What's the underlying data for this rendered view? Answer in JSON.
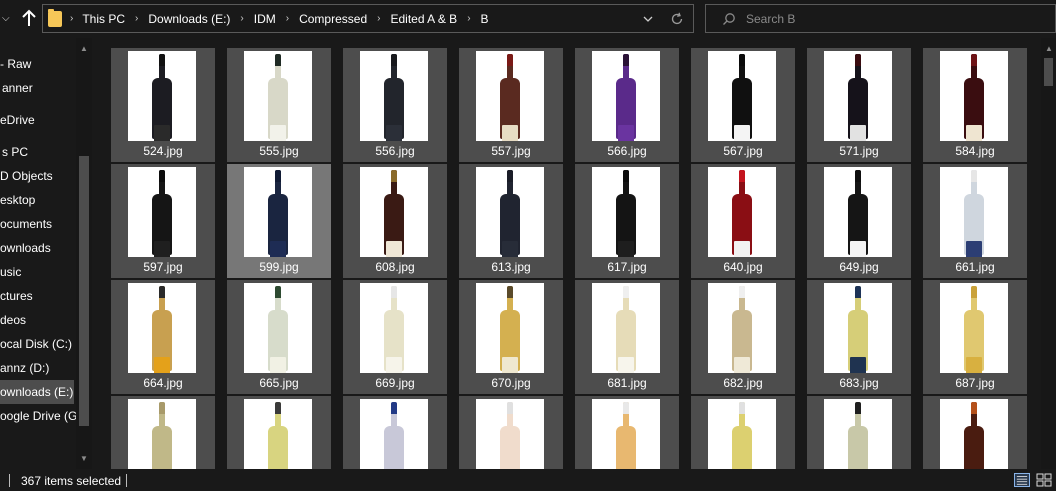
{
  "address": {
    "crumbs": [
      "This PC",
      "Downloads (E:)",
      "IDM",
      "Compressed",
      "Edited A & B",
      "B"
    ]
  },
  "search": {
    "placeholder": "Search B"
  },
  "nav_pane": {
    "items": [
      {
        "label": "- Raw"
      },
      {
        "label": "anner"
      },
      {
        "label": "eDrive"
      },
      {
        "label": "s PC"
      },
      {
        "label": "D Objects"
      },
      {
        "label": "esktop"
      },
      {
        "label": "ocuments"
      },
      {
        "label": "ownloads"
      },
      {
        "label": "usic"
      },
      {
        "label": "ctures"
      },
      {
        "label": "deos"
      },
      {
        "label": "ocal Disk (C:)"
      },
      {
        "label": "annz (D:)"
      },
      {
        "label": "ownloads (E:)",
        "selected": true
      },
      {
        "label": "oogle Drive (G:"
      }
    ]
  },
  "files": [
    {
      "name": "524.jpg",
      "color": "#1c1c22",
      "label": "#2a2a2a",
      "capsule": "#111"
    },
    {
      "name": "555.jpg",
      "color": "#d8d8c8",
      "label": "#f2f2ea",
      "capsule": "#1f2a24"
    },
    {
      "name": "556.jpg",
      "color": "#22252c",
      "label": "#2b2f38",
      "capsule": "#18191d"
    },
    {
      "name": "557.jpg",
      "color": "#5a2a20",
      "label": "#e7dcc4",
      "capsule": "#7a1a16"
    },
    {
      "name": "566.jpg",
      "color": "#5a2a8a",
      "label": "#6a34a0",
      "capsule": "#2a1236"
    },
    {
      "name": "567.jpg",
      "color": "#101010",
      "label": "#f4f4f4",
      "capsule": "#0a0a0a"
    },
    {
      "name": "571.jpg",
      "color": "#15121a",
      "label": "#e2e2e2",
      "capsule": "#3a0c10"
    },
    {
      "name": "584.jpg",
      "color": "#3a0d10",
      "label": "#efe5d1",
      "capsule": "#6e1417"
    },
    {
      "name": "597.jpg",
      "color": "#151515",
      "label": "#1f1f1f",
      "capsule": "#0c0c0c"
    },
    {
      "name": "599.jpg",
      "color": "#1a2540",
      "label": "#1e2c54",
      "capsule": "#101a34",
      "hover": true
    },
    {
      "name": "608.jpg",
      "color": "#3a1a14",
      "label": "#efe7d6",
      "capsule": "#8a6a2a"
    },
    {
      "name": "613.jpg",
      "color": "#202430",
      "label": "#272c38",
      "capsule": "#1a1d27"
    },
    {
      "name": "617.jpg",
      "color": "#141414",
      "label": "#1e1e1e",
      "capsule": "#0c0c0c"
    },
    {
      "name": "640.jpg",
      "color": "#8a0e14",
      "label": "#f2f2f2",
      "capsule": "#c4141e"
    },
    {
      "name": "649.jpg",
      "color": "#151515",
      "label": "#f4f4f4",
      "capsule": "#0e0e0e"
    },
    {
      "name": "661.jpg",
      "color": "#cfd6de",
      "label": "#2c3e74",
      "capsule": "#e6e6e6"
    },
    {
      "name": "664.jpg",
      "color": "#c8a050",
      "label": "#e4a11a",
      "capsule": "#2a2a2a"
    },
    {
      "name": "665.jpg",
      "color": "#d7dccb",
      "label": "#f1f1e4",
      "capsule": "#2d4a31"
    },
    {
      "name": "669.jpg",
      "color": "#e6e2c8",
      "label": "#f6f4ea",
      "capsule": "#e6e6e6"
    },
    {
      "name": "670.jpg",
      "color": "#d4b050",
      "label": "#efe8d0",
      "capsule": "#5a4a2a"
    },
    {
      "name": "681.jpg",
      "color": "#e6dcb8",
      "label": "#f7f5ec",
      "capsule": "#efefef"
    },
    {
      "name": "682.jpg",
      "color": "#c9b890",
      "label": "#efe9d7",
      "capsule": "#efefef"
    },
    {
      "name": "683.jpg",
      "color": "#d6ce78",
      "label": "#1f3350",
      "capsule": "#1d3357"
    },
    {
      "name": "687.jpg",
      "color": "#e0c870",
      "label": "#d8b040",
      "capsule": "#caa23a"
    },
    {
      "name": "",
      "color": "#c0b888",
      "label": "#ede6cc",
      "capsule": "#a89a6a"
    },
    {
      "name": "",
      "color": "#d8d480",
      "label": "#f4f1dc",
      "capsule": "#3a3a3a"
    },
    {
      "name": "",
      "color": "#c8c8d8",
      "label": "#1e3680",
      "capsule": "#223a86"
    },
    {
      "name": "",
      "color": "#f0dccc",
      "label": "#d45a2a",
      "capsule": "#e0e0e0"
    },
    {
      "name": "",
      "color": "#e8b870",
      "label": "#f5efe0",
      "capsule": "#e8e8e8"
    },
    {
      "name": "",
      "color": "#dcd070",
      "label": "#f3f1e6",
      "capsule": "#e0e0e0"
    },
    {
      "name": "",
      "color": "#c8c8a8",
      "label": "#ece6d4",
      "capsule": "#1f1f1f"
    },
    {
      "name": "",
      "color": "#4a1c10",
      "label": "#d06a18",
      "capsule": "#b4501a"
    }
  ],
  "status": {
    "selected_text": "367 items selected"
  }
}
